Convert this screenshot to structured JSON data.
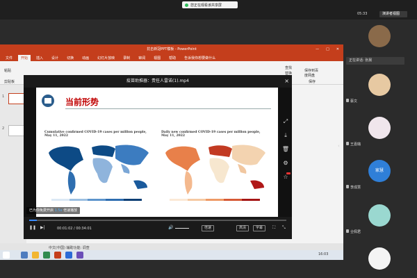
{
  "meeting": {
    "share_label": "您正在观看该共享屏",
    "clock": "05:33",
    "speaker_view": "演讲者视图"
  },
  "ppt": {
    "title": "抗击新冠PPT模板 - PowerPoint",
    "tabs": [
      "文件",
      "开始",
      "插入",
      "设计",
      "切换",
      "动画",
      "幻灯片放映",
      "录制",
      "审阅",
      "视图",
      "帮助",
      "告诉我你想要做什么"
    ],
    "active_tab": "开始",
    "ribbon": {
      "paste": "粘贴",
      "clipboard": "剪贴板",
      "find": "查找",
      "replace": "替换",
      "save_baidu": "保存到百度网盘",
      "save_group": "保存"
    },
    "status": "中文(中国)   辅助功能: 调查",
    "slide_numbers": [
      "1",
      "2"
    ]
  },
  "player": {
    "title": "疫苗助推器：责任人雷诺(1).mp4",
    "close": "×",
    "slide": {
      "title": "当前形势",
      "left_title": "Cumulative confirmed COVID-19 cases per million people, May 11, 2022",
      "right_title": "Daily new confirmed COVID-19 cases per million people, May 11, 2022"
    },
    "tip_text": "已为你免费开启",
    "tip_highlight": "1.5x",
    "tip_tail": "倍速播放",
    "time_current": "00:01:02",
    "time_total": "00:34:01",
    "progress": 0.03,
    "buttons": [
      "倍速",
      "高清",
      "字幕"
    ]
  },
  "taskbar": {
    "clock": "16:03"
  },
  "participants": {
    "speaking_label": "正在讲话: 张晨",
    "names": [
      "蔡文",
      "王嘉璐",
      "李成慧",
      "仝佩君"
    ],
    "text_avatar": "家慧"
  }
}
